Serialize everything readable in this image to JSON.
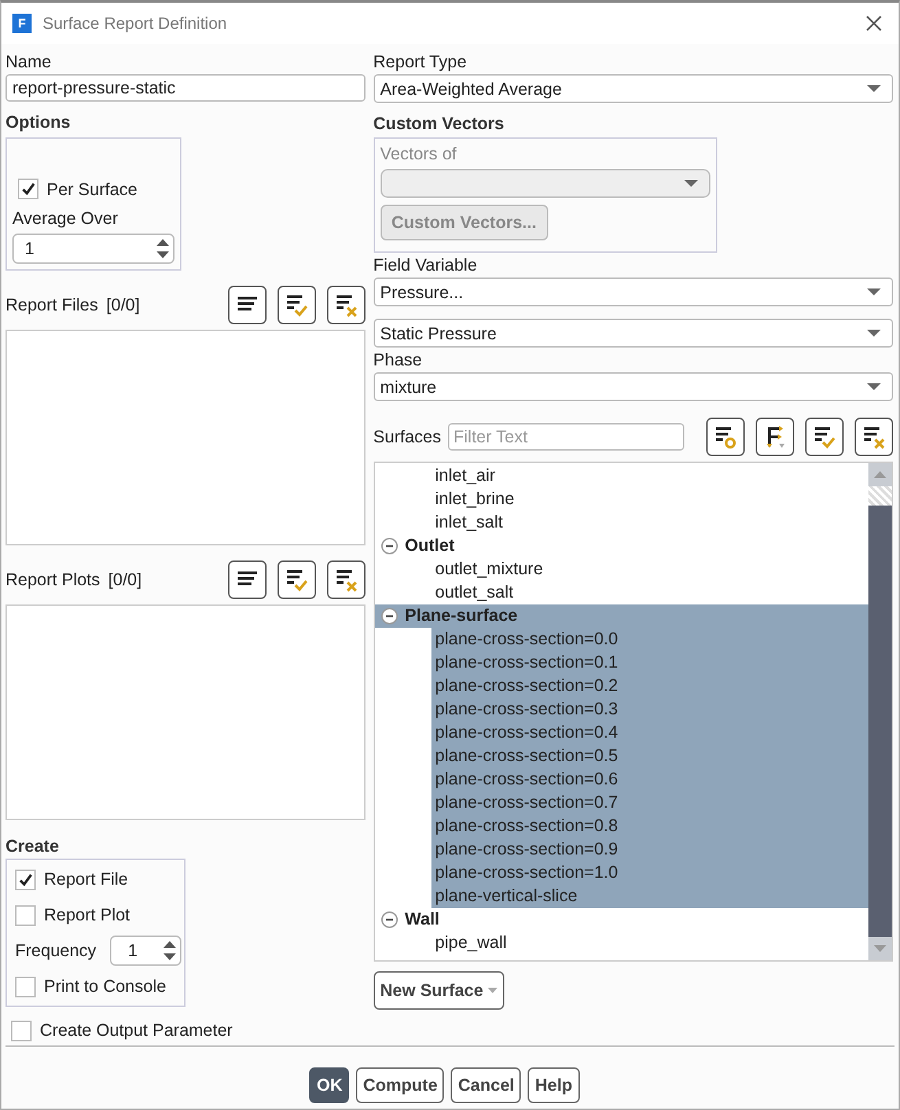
{
  "window": {
    "title": "Surface Report Definition",
    "app_icon_letter": "F"
  },
  "name": {
    "label": "Name",
    "value": "report-pressure-static"
  },
  "options": {
    "title": "Options",
    "per_surface": {
      "label": "Per Surface",
      "checked": true
    },
    "average_over": {
      "label": "Average Over",
      "value": "1"
    }
  },
  "report_files": {
    "label": "Report Files",
    "count": "[0/0]"
  },
  "report_plots": {
    "label": "Report Plots",
    "count": "[0/0]"
  },
  "create": {
    "title": "Create",
    "items": [
      {
        "kind": "checkbox",
        "label": "Report File",
        "checked": true
      },
      {
        "kind": "checkbox",
        "label": "Report Plot",
        "checked": false
      },
      {
        "kind": "spinner",
        "label": "Frequency",
        "value": "1"
      },
      {
        "kind": "checkbox",
        "label": "Print to Console",
        "checked": false
      }
    ]
  },
  "create_output_parameter": {
    "label": "Create Output Parameter",
    "checked": false
  },
  "report_type": {
    "label": "Report Type",
    "value": "Area-Weighted Average"
  },
  "custom_vectors": {
    "title": "Custom Vectors",
    "vectors_of_label": "Vectors of",
    "disabled": true,
    "button": "Custom Vectors..."
  },
  "field_variable": {
    "label": "Field Variable",
    "category": "Pressure...",
    "value": "Static Pressure"
  },
  "phase": {
    "label": "Phase",
    "value": "mixture"
  },
  "surfaces": {
    "label": "Surfaces",
    "filter_placeholder": "Filter Text",
    "tree": [
      {
        "children": [
          {
            "label": "inlet_air",
            "selected": false
          },
          {
            "label": "inlet_brine",
            "selected": false
          },
          {
            "label": "inlet_salt",
            "selected": false
          }
        ]
      },
      {
        "label": "Outlet",
        "expanded": true,
        "selected": false,
        "children": [
          {
            "label": "outlet_mixture",
            "selected": false
          },
          {
            "label": "outlet_salt",
            "selected": false
          }
        ]
      },
      {
        "label": "Plane-surface",
        "expanded": true,
        "selected": true,
        "children": [
          {
            "label": "plane-cross-section=0.0",
            "selected": true
          },
          {
            "label": "plane-cross-section=0.1",
            "selected": true
          },
          {
            "label": "plane-cross-section=0.2",
            "selected": true
          },
          {
            "label": "plane-cross-section=0.3",
            "selected": true
          },
          {
            "label": "plane-cross-section=0.4",
            "selected": true
          },
          {
            "label": "plane-cross-section=0.5",
            "selected": true
          },
          {
            "label": "plane-cross-section=0.6",
            "selected": true
          },
          {
            "label": "plane-cross-section=0.7",
            "selected": true
          },
          {
            "label": "plane-cross-section=0.8",
            "selected": true
          },
          {
            "label": "plane-cross-section=0.9",
            "selected": true
          },
          {
            "label": "plane-cross-section=1.0",
            "selected": true
          },
          {
            "label": "plane-vertical-slice",
            "selected": true
          }
        ]
      },
      {
        "label": "Wall",
        "expanded": true,
        "selected": false,
        "children": [
          {
            "label": "pipe_wall",
            "selected": false
          }
        ]
      }
    ]
  },
  "new_surface_button": "New Surface",
  "buttons": [
    {
      "label": "OK",
      "default": true
    },
    {
      "label": "Compute",
      "default": false
    },
    {
      "label": "Cancel",
      "default": false
    },
    {
      "label": "Help",
      "default": false
    }
  ]
}
